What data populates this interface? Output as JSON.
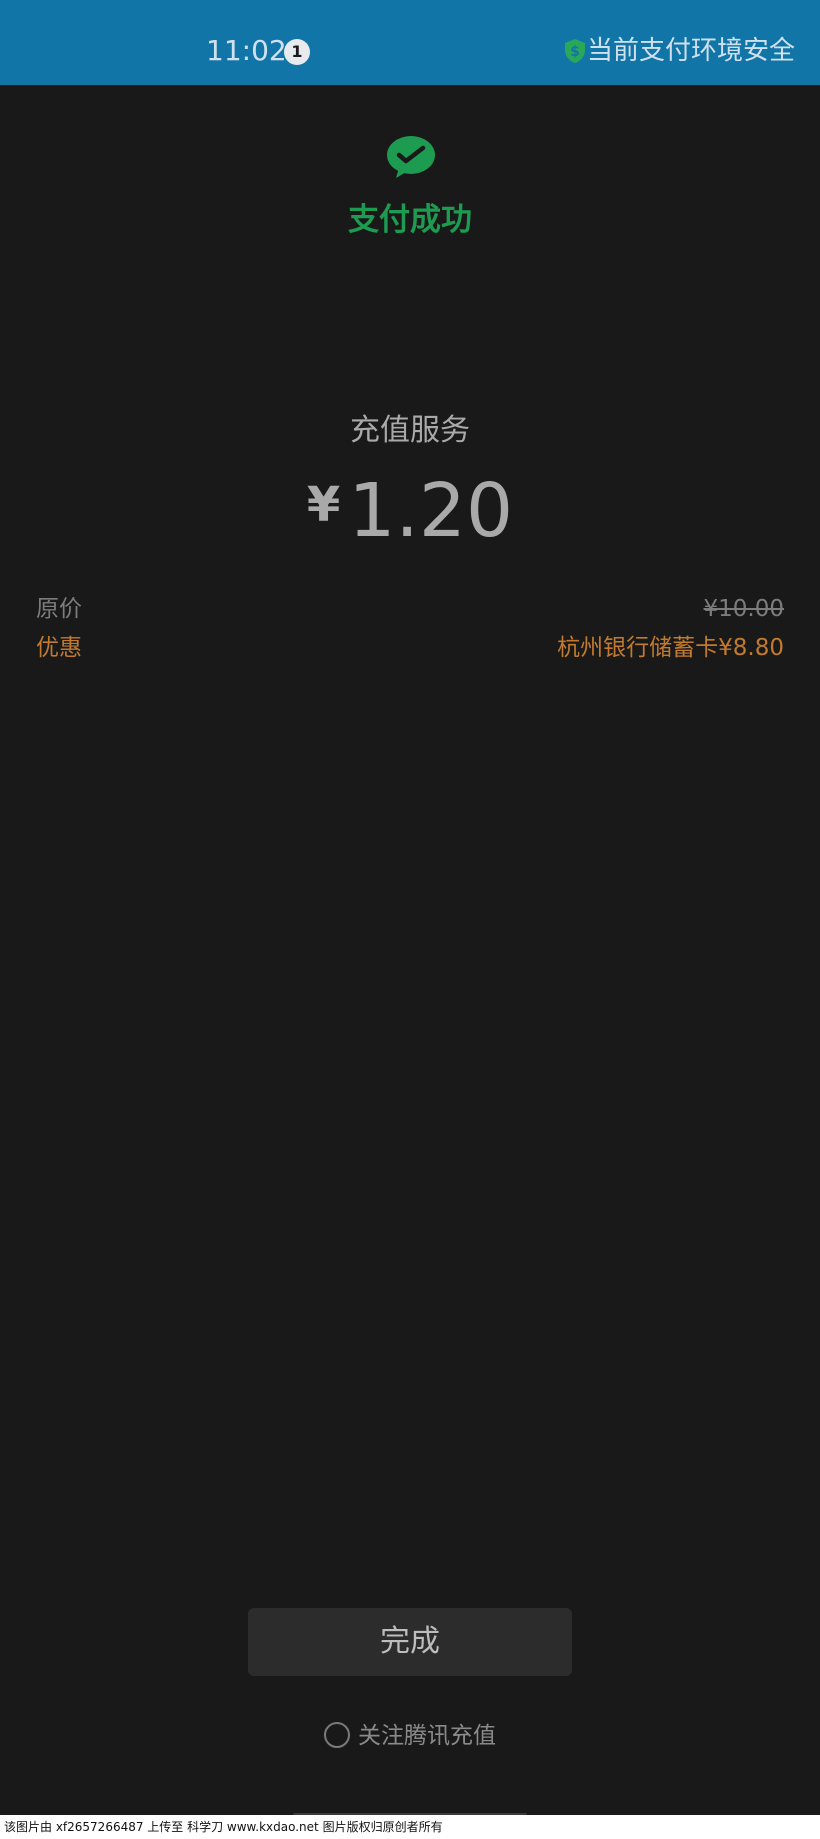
{
  "status_bar": {
    "time": "11:02",
    "notification_count": "1",
    "safety_text": "当前支付环境安全",
    "background_color": "#1275a8"
  },
  "header": {
    "logo_icon": "wechat-pay-icon",
    "title": "支付成功",
    "accent_color": "#1c9b51"
  },
  "payment": {
    "service_name": "充值服务",
    "currency_symbol": "¥",
    "amount": "1.20"
  },
  "details": {
    "original_label": "原价",
    "original_value": "¥10.00",
    "discount_label": "优惠",
    "discount_value": "杭州银行储蓄卡¥8.80",
    "discount_color": "#c27a2e"
  },
  "actions": {
    "done_label": "完成",
    "follow_label": "关注腾讯充值"
  },
  "watermark": {
    "text": "该图片由 xf2657266487 上传至 科学刀 www.kxdao.net 图片版权归原创者所有"
  }
}
